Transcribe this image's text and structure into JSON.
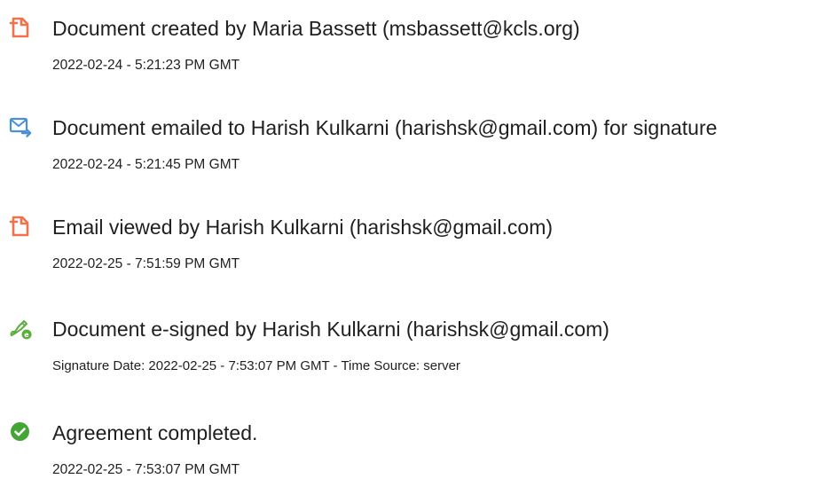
{
  "events": [
    {
      "icon": "document-created-icon",
      "title": "Document created by Maria Bassett (msbassett@kcls.org)",
      "detail": "2022-02-24 - 5:21:23 PM GMT"
    },
    {
      "icon": "email-sent-icon",
      "title": "Document emailed to Harish Kulkarni (harishsk@gmail.com) for signature",
      "detail": "2022-02-24 - 5:21:45 PM GMT"
    },
    {
      "icon": "email-viewed-icon",
      "title": "Email viewed by Harish Kulkarni (harishsk@gmail.com)",
      "detail": "2022-02-25 - 7:51:59 PM GMT"
    },
    {
      "icon": "e-sign-pen-icon",
      "title": "Document e-signed by Harish Kulkarni (harishsk@gmail.com)",
      "detail": "Signature Date: 2022-02-25 - 7:53:07 PM GMT - Time Source: server"
    },
    {
      "icon": "check-circle-icon",
      "title": "Agreement completed.",
      "detail": "2022-02-25 - 7:53:07 PM GMT"
    }
  ],
  "colors": {
    "document_orange": "#F0724A",
    "email_blue": "#4A90D9",
    "sign_green": "#5BAE3A",
    "check_green": "#43A534"
  }
}
